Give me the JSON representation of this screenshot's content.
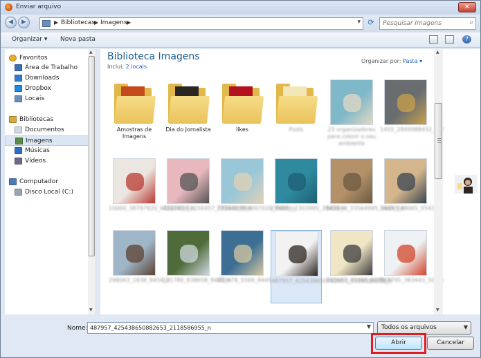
{
  "window": {
    "title": "Enviar arquivo",
    "close_glyph": "✕"
  },
  "nav": {
    "back_glyph": "◀",
    "forward_glyph": "▶",
    "breadcrumb": [
      "Bibliotecas",
      "Imagens"
    ],
    "sep_glyph": "▶",
    "dropdown_glyph": "▾",
    "refresh_glyph": "⟳",
    "search_placeholder": "Pesquisar Imagens",
    "search_glyph": "⌕"
  },
  "toolbar": {
    "organize": "Organizar ▾",
    "new_folder": "Nova pasta",
    "help_glyph": "?"
  },
  "sidebar": {
    "favorites": [
      {
        "label": "Favoritos",
        "icon": "star-icon",
        "color": "#e8b02a"
      },
      {
        "label": "Área de Trabalho",
        "icon": "desktop-icon",
        "color": "#3b6fb6"
      },
      {
        "label": "Downloads",
        "icon": "downloads-icon",
        "color": "#2e7dd1"
      },
      {
        "label": "Dropbox",
        "icon": "dropbox-icon",
        "color": "#1e88e5"
      },
      {
        "label": "Locais",
        "icon": "places-icon",
        "color": "#6b8fb8"
      }
    ],
    "libraries": [
      {
        "label": "Bibliotecas",
        "icon": "library-icon",
        "color": "#d8a93c"
      },
      {
        "label": "Documentos",
        "icon": "documents-icon",
        "color": "#cfd9e6"
      },
      {
        "label": "Imagens",
        "icon": "pictures-icon",
        "color": "#5b8c4a"
      },
      {
        "label": "Músicas",
        "icon": "music-icon",
        "color": "#2d6fc2"
      },
      {
        "label": "Vídeos",
        "icon": "videos-icon",
        "color": "#6a6a8a"
      }
    ],
    "computer": [
      {
        "label": "Computador",
        "icon": "computer-icon",
        "color": "#4d7ab5"
      },
      {
        "label": "Disco Local (C:)",
        "icon": "disk-icon",
        "color": "#9aa5b3"
      }
    ]
  },
  "content": {
    "library_title": "Biblioteca Imagens",
    "includes_label": "Inclui:",
    "includes_link": "2 locais",
    "arrange_label": "Organizar por:",
    "arrange_value": "Pasta ▾"
  },
  "items": [
    {
      "caption": "Amostras de Imagens",
      "kind": "folder",
      "paper": "#c44a1c",
      "blur": false
    },
    {
      "caption": "Dia do Jornalista",
      "kind": "folder",
      "paper": "#2b2622",
      "blur": false
    },
    {
      "caption": "likes",
      "kind": "folder",
      "paper": "#b3121e",
      "blur": false
    },
    {
      "caption": "Posts",
      "kind": "folder",
      "paper": "#f3e7b8",
      "blur": true
    },
    {
      "caption": "23 organizadores para colorir o seu ambiente",
      "kind": "image",
      "bg": "#7fb8c8",
      "fg": "#e3d8c4",
      "blur": true
    },
    {
      "caption": "1455_2849988432_1278867_n",
      "kind": "image",
      "bg": "#6a6d70",
      "fg": "#c9a24a",
      "blur": true
    },
    {
      "caption": "10000_38797920_63527438_n",
      "kind": "image",
      "bg": "#ece6e1",
      "fg": "#b93a32",
      "blur": true
    },
    {
      "caption": "426685_10150457_28593085_n",
      "kind": "image",
      "bg": "#e8b8be",
      "fg": "#545454",
      "blur": true
    },
    {
      "caption": "773640_888007026_8485_n",
      "kind": "image",
      "bg": "#9ac7d8",
      "fg": "#e1d2b5",
      "blur": true
    },
    {
      "caption": "279040_2303985_38450_n",
      "kind": "image",
      "bg": "#2f8aa0",
      "fg": "#1e5f72",
      "blur": true
    },
    {
      "caption": "563040_33564995_36045_n",
      "kind": "image",
      "bg": "#b59169",
      "fg": "#6b5a42",
      "blur": true
    },
    {
      "caption": "5445_589065_5543_n",
      "kind": "image",
      "bg": "#d4b58c",
      "fg": "#394652",
      "blur": true
    },
    {
      "caption": "298063_1838_8454_n",
      "kind": "image",
      "bg": "#9fb6c8",
      "fg": "#5c4232",
      "blur": true
    },
    {
      "caption": "221780_838658_8435_n",
      "kind": "image",
      "bg": "#4f6b3a",
      "fg": "#cfd8df",
      "blur": true
    },
    {
      "caption": "403478_5569_8445_n",
      "kind": "image",
      "bg": "#3c6f93",
      "fg": "#d6c7a2",
      "blur": true
    },
    {
      "caption": "487957_425438650882653_2118586955_n",
      "kind": "image",
      "bg": "#f2f2f2",
      "fg": "#2c2420",
      "blur": true,
      "selected": true
    },
    {
      "caption": "733047_45660_6555_n",
      "kind": "image",
      "bg": "#f0e6c6",
      "fg": "#3c3c3c",
      "blur": true
    },
    {
      "caption": "563795_383443_503_n",
      "kind": "image",
      "bg": "#eef2f4",
      "fg": "#d2452b",
      "blur": true
    }
  ],
  "bottom": {
    "name_label": "Nome:",
    "name_value": "487957_425438650882653_2118586955_n",
    "filetype": "Todos os arquivos",
    "open_label": "Abrir",
    "cancel_label": "Cancelar",
    "highlight_color": "#e11b22"
  }
}
